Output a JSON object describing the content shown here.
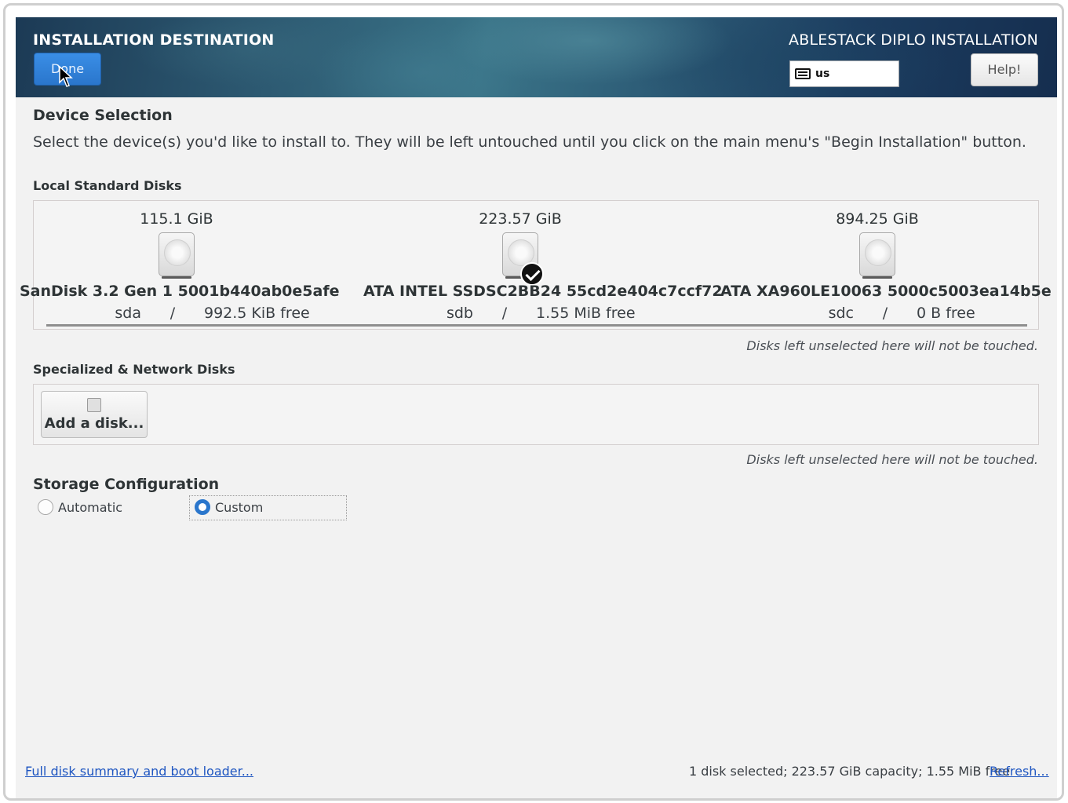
{
  "header": {
    "title": "INSTALLATION DESTINATION",
    "done_label": "Done",
    "product": "ABLESTACK DIPLO INSTALLATION",
    "keyboard_layout": "us",
    "help_label": "Help!"
  },
  "device_selection": {
    "title": "Device Selection",
    "description": "Select the device(s) you'd like to install to.  They will be left untouched until you click on the main menu's \"Begin Installation\" button."
  },
  "local_disks": {
    "label": "Local Standard Disks",
    "disks": [
      {
        "size": "115.1 GiB",
        "name": "SanDisk 3.2 Gen 1 5001b440ab0e5afe",
        "device": "sda",
        "sep": "/",
        "free": "992.5 KiB free",
        "selected": false
      },
      {
        "size": "223.57 GiB",
        "name": "ATA INTEL SSDSC2BB24 55cd2e404c7ccf72",
        "device": "sdb",
        "sep": "/",
        "free": "1.55 MiB free",
        "selected": true
      },
      {
        "size": "894.25 GiB",
        "name": "ATA XA960LE10063 5000c5003ea14b5e",
        "device": "sdc",
        "sep": "/",
        "free": "0 B free",
        "selected": false
      }
    ],
    "note": "Disks left unselected here will not be touched."
  },
  "network_disks": {
    "label": "Specialized & Network Disks",
    "add_label": "Add a disk...",
    "note": "Disks left unselected here will not be touched."
  },
  "storage": {
    "title": "Storage Configuration",
    "automatic_label": "Automatic",
    "custom_label": "Custom",
    "selected": "Custom"
  },
  "footer": {
    "summary_link": "Full disk summary and boot loader...",
    "status": "1 disk selected; 223.57 GiB capacity; 1.55 MiB free",
    "refresh_link": "Refresh..."
  }
}
